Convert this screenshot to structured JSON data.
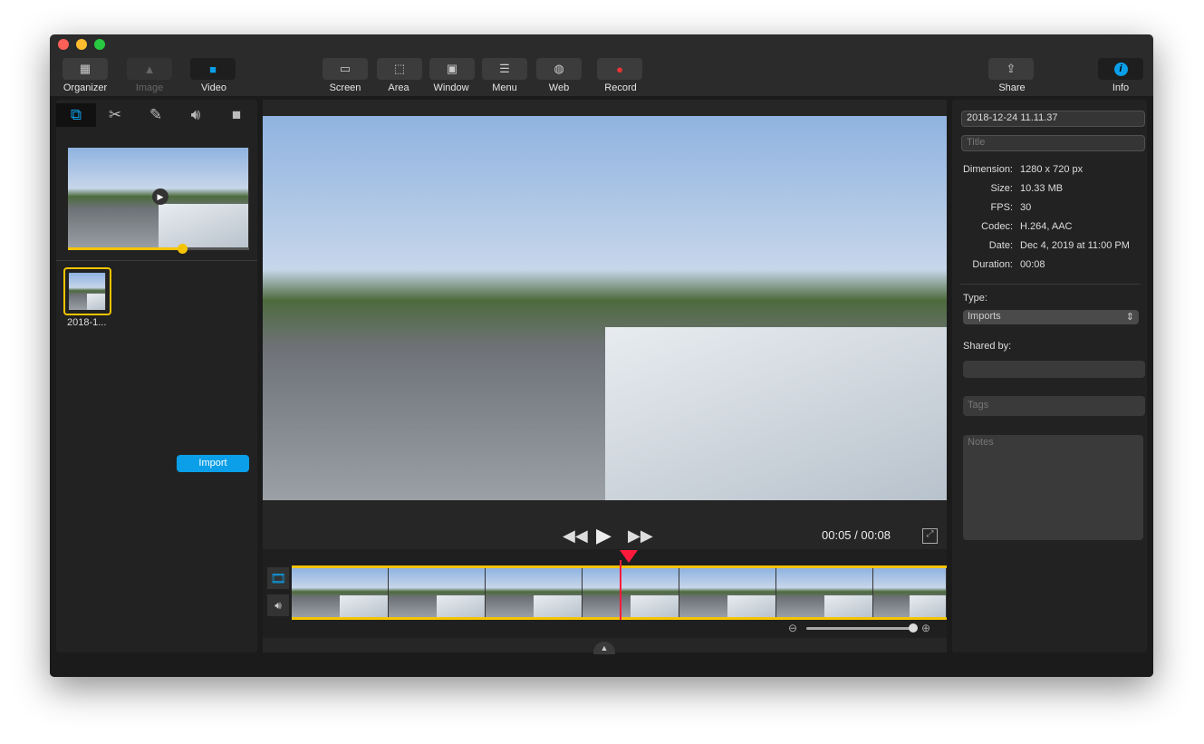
{
  "toolbar": {
    "items": [
      {
        "label": "Organizer",
        "icon": "grid-icon"
      },
      {
        "label": "Image",
        "icon": "image-icon",
        "disabled": true
      },
      {
        "label": "Video",
        "icon": "video-icon",
        "active": true
      },
      {
        "label": "Screen",
        "icon": "screen-icon"
      },
      {
        "label": "Area",
        "icon": "area-icon"
      },
      {
        "label": "Window",
        "icon": "window-icon"
      },
      {
        "label": "Menu",
        "icon": "menu-icon"
      },
      {
        "label": "Web",
        "icon": "globe-icon"
      },
      {
        "label": "Record",
        "icon": "record-icon"
      },
      {
        "label": "Share",
        "icon": "share-icon"
      },
      {
        "label": "Info",
        "icon": "info-icon",
        "active": true
      }
    ]
  },
  "left": {
    "tabs": [
      "clips-icon",
      "scissors-icon",
      "annotate-icon",
      "speaker-icon",
      "camera-icon"
    ],
    "preview_progress": 0.63,
    "thumb_label": "2018-1...",
    "import_label": "Import"
  },
  "player": {
    "time": "00:05",
    "duration": "/ 00:08",
    "playhead_fraction": 0.5
  },
  "info": {
    "filename": "2018-12-24 11.11.37",
    "title_placeholder": "Title",
    "rows": [
      {
        "k": "Dimension:",
        "v": "1280 x 720 px"
      },
      {
        "k": "Size:",
        "v": "10.33 MB"
      },
      {
        "k": "FPS:",
        "v": "30"
      },
      {
        "k": "Codec:",
        "v": "H.264, AAC"
      },
      {
        "k": "Date:",
        "v": "Dec 4, 2019 at 11:00 PM"
      },
      {
        "k": "Duration:",
        "v": "00:08"
      }
    ],
    "type_label": "Type:",
    "type_value": "Imports",
    "shared_label": "Shared by:",
    "tags_placeholder": "Tags",
    "notes_placeholder": "Notes"
  },
  "colors": {
    "accent": "#0a9fe8",
    "timeline": "#f5c400",
    "playhead": "#ff1a3c"
  }
}
